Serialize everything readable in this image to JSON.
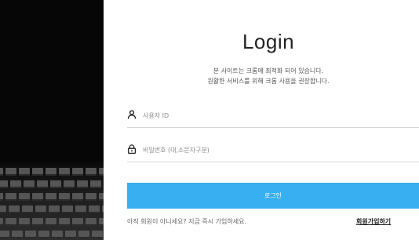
{
  "login": {
    "title": "Login",
    "notice_line1": "본 사이트는 크롬에 최적화 되어 있습니다.",
    "notice_line2": "원활한 서비스를 위해 크롬 사용을 권장합니다.",
    "user_field": {
      "icon": "user-icon",
      "placeholder": "사용자 ID",
      "value": ""
    },
    "password_field": {
      "icon": "lock-icon",
      "placeholder": "비밀번호 (대,소문자구분)",
      "value": ""
    },
    "submit_label": "로그인",
    "signup_prompt": "아직 회원이 아니세요? 지금 즉시 가입하세요.",
    "signup_link": "회원가입하기"
  },
  "colors": {
    "button": "#38aff0",
    "left_panel": "#060606"
  }
}
